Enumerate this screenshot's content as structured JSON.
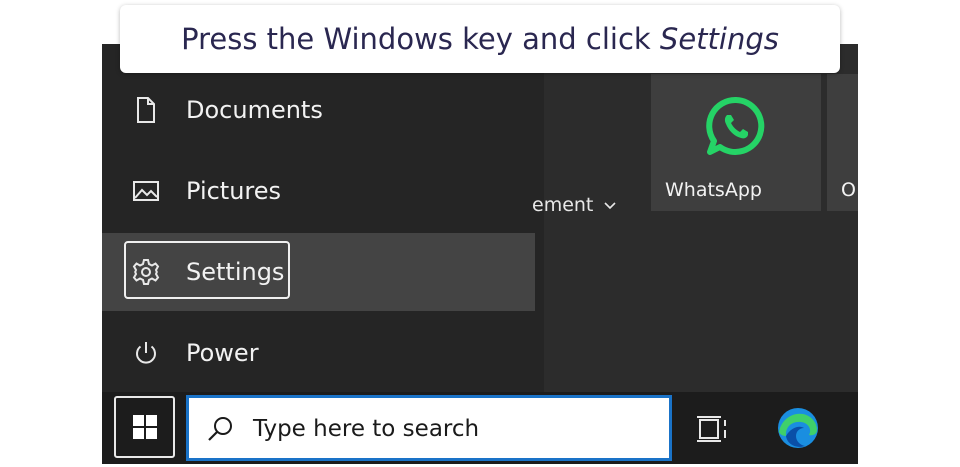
{
  "callout": {
    "text_prefix": "Press the Windows key and click ",
    "text_emphasis": "Settings"
  },
  "start_menu": {
    "items": [
      {
        "label": "Documents",
        "icon": "document-icon"
      },
      {
        "label": "Pictures",
        "icon": "pictures-icon"
      },
      {
        "label": "Settings",
        "icon": "gear-icon",
        "selected": true
      },
      {
        "label": "Power",
        "icon": "power-icon"
      }
    ],
    "group_label": "ement",
    "tiles": [
      {
        "label": "WhatsApp",
        "icon": "whatsapp-icon"
      },
      {
        "label": "O",
        "icon": ""
      }
    ]
  },
  "taskbar": {
    "search_placeholder": "Type here to search",
    "icons": [
      "windows-start-icon",
      "search-icon",
      "task-view-icon",
      "edge-icon"
    ]
  },
  "colors": {
    "callout_text": "#2a2750",
    "search_border": "#1a73c8",
    "whatsapp_green": "#25d366",
    "menu_selected": "#444444"
  }
}
